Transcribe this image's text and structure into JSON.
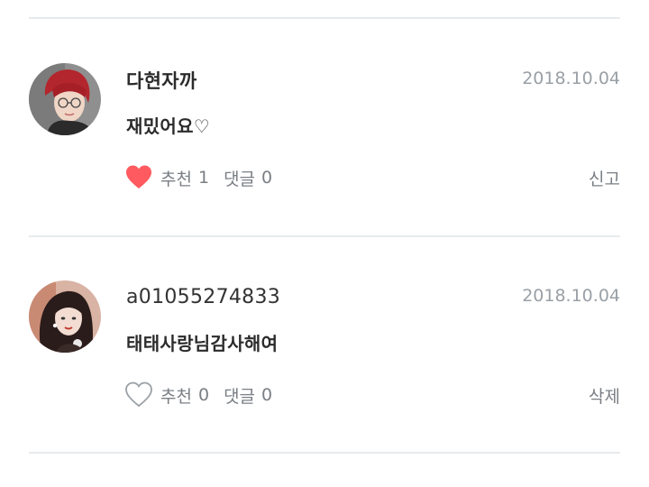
{
  "colors": {
    "divider": "#e7ebee",
    "heart_filled": "#ff5a5f",
    "heart_outline": "#9aa0a6",
    "meta_text": "#9aa0a6",
    "body_text": "#2b2b2b"
  },
  "comments": [
    {
      "nickname": "다현자까",
      "date": "2018.10.04",
      "content": "재밌어요♡",
      "like_label": "추천",
      "like_count": "1",
      "liked": true,
      "reply_label": "댓글",
      "reply_count": "0",
      "action_label": "신고",
      "avatar_icon": "user-avatar-red-hair"
    },
    {
      "nickname": "a01055274833",
      "date": "2018.10.04",
      "content": "태태사랑님감사해여",
      "like_label": "추천",
      "like_count": "0",
      "liked": false,
      "reply_label": "댓글",
      "reply_count": "0",
      "action_label": "삭제",
      "avatar_icon": "user-avatar-dark-hair"
    }
  ]
}
